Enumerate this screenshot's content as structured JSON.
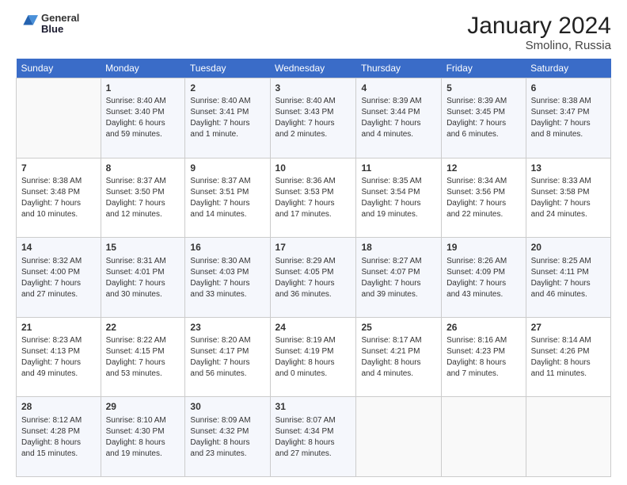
{
  "logo": {
    "line1": "General",
    "line2": "Blue"
  },
  "title": "January 2024",
  "subtitle": "Smolino, Russia",
  "weekdays": [
    "Sunday",
    "Monday",
    "Tuesday",
    "Wednesday",
    "Thursday",
    "Friday",
    "Saturday"
  ],
  "weeks": [
    [
      {
        "day": "",
        "info": ""
      },
      {
        "day": "1",
        "info": "Sunrise: 8:40 AM\nSunset: 3:40 PM\nDaylight: 6 hours\nand 59 minutes."
      },
      {
        "day": "2",
        "info": "Sunrise: 8:40 AM\nSunset: 3:41 PM\nDaylight: 7 hours\nand 1 minute."
      },
      {
        "day": "3",
        "info": "Sunrise: 8:40 AM\nSunset: 3:43 PM\nDaylight: 7 hours\nand 2 minutes."
      },
      {
        "day": "4",
        "info": "Sunrise: 8:39 AM\nSunset: 3:44 PM\nDaylight: 7 hours\nand 4 minutes."
      },
      {
        "day": "5",
        "info": "Sunrise: 8:39 AM\nSunset: 3:45 PM\nDaylight: 7 hours\nand 6 minutes."
      },
      {
        "day": "6",
        "info": "Sunrise: 8:38 AM\nSunset: 3:47 PM\nDaylight: 7 hours\nand 8 minutes."
      }
    ],
    [
      {
        "day": "7",
        "info": "Sunrise: 8:38 AM\nSunset: 3:48 PM\nDaylight: 7 hours\nand 10 minutes."
      },
      {
        "day": "8",
        "info": "Sunrise: 8:37 AM\nSunset: 3:50 PM\nDaylight: 7 hours\nand 12 minutes."
      },
      {
        "day": "9",
        "info": "Sunrise: 8:37 AM\nSunset: 3:51 PM\nDaylight: 7 hours\nand 14 minutes."
      },
      {
        "day": "10",
        "info": "Sunrise: 8:36 AM\nSunset: 3:53 PM\nDaylight: 7 hours\nand 17 minutes."
      },
      {
        "day": "11",
        "info": "Sunrise: 8:35 AM\nSunset: 3:54 PM\nDaylight: 7 hours\nand 19 minutes."
      },
      {
        "day": "12",
        "info": "Sunrise: 8:34 AM\nSunset: 3:56 PM\nDaylight: 7 hours\nand 22 minutes."
      },
      {
        "day": "13",
        "info": "Sunrise: 8:33 AM\nSunset: 3:58 PM\nDaylight: 7 hours\nand 24 minutes."
      }
    ],
    [
      {
        "day": "14",
        "info": "Sunrise: 8:32 AM\nSunset: 4:00 PM\nDaylight: 7 hours\nand 27 minutes."
      },
      {
        "day": "15",
        "info": "Sunrise: 8:31 AM\nSunset: 4:01 PM\nDaylight: 7 hours\nand 30 minutes."
      },
      {
        "day": "16",
        "info": "Sunrise: 8:30 AM\nSunset: 4:03 PM\nDaylight: 7 hours\nand 33 minutes."
      },
      {
        "day": "17",
        "info": "Sunrise: 8:29 AM\nSunset: 4:05 PM\nDaylight: 7 hours\nand 36 minutes."
      },
      {
        "day": "18",
        "info": "Sunrise: 8:27 AM\nSunset: 4:07 PM\nDaylight: 7 hours\nand 39 minutes."
      },
      {
        "day": "19",
        "info": "Sunrise: 8:26 AM\nSunset: 4:09 PM\nDaylight: 7 hours\nand 43 minutes."
      },
      {
        "day": "20",
        "info": "Sunrise: 8:25 AM\nSunset: 4:11 PM\nDaylight: 7 hours\nand 46 minutes."
      }
    ],
    [
      {
        "day": "21",
        "info": "Sunrise: 8:23 AM\nSunset: 4:13 PM\nDaylight: 7 hours\nand 49 minutes."
      },
      {
        "day": "22",
        "info": "Sunrise: 8:22 AM\nSunset: 4:15 PM\nDaylight: 7 hours\nand 53 minutes."
      },
      {
        "day": "23",
        "info": "Sunrise: 8:20 AM\nSunset: 4:17 PM\nDaylight: 7 hours\nand 56 minutes."
      },
      {
        "day": "24",
        "info": "Sunrise: 8:19 AM\nSunset: 4:19 PM\nDaylight: 8 hours\nand 0 minutes."
      },
      {
        "day": "25",
        "info": "Sunrise: 8:17 AM\nSunset: 4:21 PM\nDaylight: 8 hours\nand 4 minutes."
      },
      {
        "day": "26",
        "info": "Sunrise: 8:16 AM\nSunset: 4:23 PM\nDaylight: 8 hours\nand 7 minutes."
      },
      {
        "day": "27",
        "info": "Sunrise: 8:14 AM\nSunset: 4:26 PM\nDaylight: 8 hours\nand 11 minutes."
      }
    ],
    [
      {
        "day": "28",
        "info": "Sunrise: 8:12 AM\nSunset: 4:28 PM\nDaylight: 8 hours\nand 15 minutes."
      },
      {
        "day": "29",
        "info": "Sunrise: 8:10 AM\nSunset: 4:30 PM\nDaylight: 8 hours\nand 19 minutes."
      },
      {
        "day": "30",
        "info": "Sunrise: 8:09 AM\nSunset: 4:32 PM\nDaylight: 8 hours\nand 23 minutes."
      },
      {
        "day": "31",
        "info": "Sunrise: 8:07 AM\nSunset: 4:34 PM\nDaylight: 8 hours\nand 27 minutes."
      },
      {
        "day": "",
        "info": ""
      },
      {
        "day": "",
        "info": ""
      },
      {
        "day": "",
        "info": ""
      }
    ]
  ]
}
